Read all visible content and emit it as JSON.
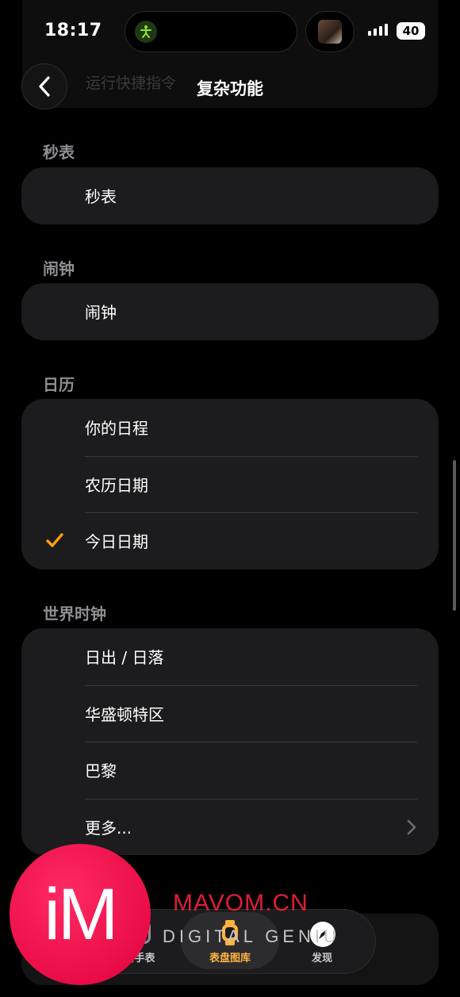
{
  "status_bar": {
    "time": "18:17",
    "battery": "40"
  },
  "header": {
    "ghost_text": "运行快捷指令",
    "title": "复杂功能"
  },
  "sections": [
    {
      "label": "秒表",
      "items": [
        {
          "label": "秒表"
        }
      ]
    },
    {
      "label": "闹钟",
      "items": [
        {
          "label": "闹钟"
        }
      ]
    },
    {
      "label": "日历",
      "items": [
        {
          "label": "你的日程"
        },
        {
          "label": "农历日期"
        },
        {
          "label": "今日日期",
          "selected": true
        }
      ]
    },
    {
      "label": "世界时钟",
      "items": [
        {
          "label": "日出 / 日落"
        },
        {
          "label": "华盛顿特区"
        },
        {
          "label": "巴黎"
        },
        {
          "label": "更多..."
        }
      ]
    }
  ],
  "tabs": [
    {
      "label": "我的手表",
      "visible_text": "的手表"
    },
    {
      "label": "表盘图库",
      "active": true
    },
    {
      "label": "发现"
    }
  ],
  "watermark": {
    "badge": "iM",
    "site": "MAVOM.CN",
    "overlay": "DIGITAL GENIU"
  },
  "colors": {
    "accent": "#ff9f0a",
    "active_tab": "#ffb340",
    "card": "#1c1c1e",
    "secondary_text": "#8e8e93"
  }
}
